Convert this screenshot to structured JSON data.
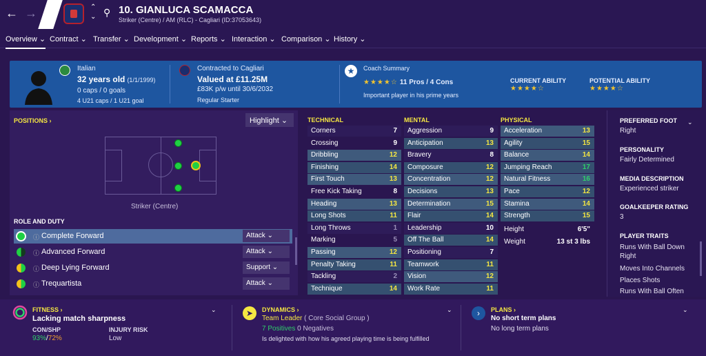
{
  "header": {
    "name": "10. GIANLUCA SCAMACCA",
    "subtitle": "Striker (Centre) / AM (RLC) - Cagliari (ID:37053643)"
  },
  "menu": [
    "Overview",
    "Contract",
    "Transfer",
    "Development",
    "Reports",
    "Interaction",
    "Comparison",
    "History"
  ],
  "summary": {
    "nationality": "Italian",
    "age": "32 years old",
    "dob": "(1/1/1999)",
    "caps": "0 caps / 0 goals",
    "u21": "4 U21 caps / 1 U21 goal",
    "contract_label": "Contracted to Cagliari",
    "value": "Valued at £11.25M",
    "wage": "£83K p/w until 30/6/2032",
    "status": "Regular Starter",
    "coach_title": "Coach Summary",
    "coach_pros": "11 Pros / 4 Cons",
    "coach_note": "Important player in his prime years",
    "ca_label": "CURRENT ABILITY",
    "pa_label": "POTENTIAL ABILITY",
    "ca_stars": 3.5,
    "pa_stars": 3.5
  },
  "positions": {
    "label": "POSITIONS",
    "highlight": "Highlight",
    "caption": "Striker (Centre)"
  },
  "role_duty": {
    "label": "ROLE AND DUTY",
    "roles": [
      {
        "name": "Complete Forward",
        "duty": "Attack"
      },
      {
        "name": "Advanced Forward",
        "duty": "Attack"
      },
      {
        "name": "Deep Lying Forward",
        "duty": "Support"
      },
      {
        "name": "Trequartista",
        "duty": "Attack"
      }
    ]
  },
  "technical": {
    "label": "TECHNICAL",
    "rows": [
      [
        "Corners",
        "7"
      ],
      [
        "Crossing",
        "9"
      ],
      [
        "Dribbling",
        "12"
      ],
      [
        "Finishing",
        "14"
      ],
      [
        "First Touch",
        "13"
      ],
      [
        "Free Kick Taking",
        "8"
      ],
      [
        "Heading",
        "13"
      ],
      [
        "Long Shots",
        "11"
      ],
      [
        "Long Throws",
        "1"
      ],
      [
        "Marking",
        "5"
      ],
      [
        "Passing",
        "12"
      ],
      [
        "Penalty Taking",
        "11"
      ],
      [
        "Tackling",
        "2"
      ],
      [
        "Technique",
        "14"
      ]
    ]
  },
  "mental": {
    "label": "MENTAL",
    "rows": [
      [
        "Aggression",
        "9"
      ],
      [
        "Anticipation",
        "13"
      ],
      [
        "Bravery",
        "8"
      ],
      [
        "Composure",
        "12"
      ],
      [
        "Concentration",
        "12"
      ],
      [
        "Decisions",
        "13"
      ],
      [
        "Determination",
        "15"
      ],
      [
        "Flair",
        "14"
      ],
      [
        "Leadership",
        "10"
      ],
      [
        "Off The Ball",
        "14"
      ],
      [
        "Positioning",
        "7"
      ],
      [
        "Teamwork",
        "11"
      ],
      [
        "Vision",
        "12"
      ],
      [
        "Work Rate",
        "11"
      ]
    ]
  },
  "physical": {
    "label": "PHYSICAL",
    "rows": [
      [
        "Acceleration",
        "13"
      ],
      [
        "Agility",
        "15"
      ],
      [
        "Balance",
        "14"
      ],
      [
        "Jumping Reach",
        "17"
      ],
      [
        "Natural Fitness",
        "16"
      ],
      [
        "Pace",
        "12"
      ],
      [
        "Stamina",
        "14"
      ],
      [
        "Strength",
        "15"
      ]
    ],
    "height_label": "Height",
    "height": "6'5\"",
    "weight_label": "Weight",
    "weight": "13 st 3 lbs"
  },
  "side": {
    "foot_h": "PREFERRED FOOT",
    "foot": "Right",
    "pers_h": "PERSONALITY",
    "pers": "Fairly Determined",
    "media_h": "MEDIA DESCRIPTION",
    "media": "Experienced striker",
    "gk_h": "GOALKEEPER RATING",
    "gk": "3",
    "traits_h": "PLAYER TRAITS",
    "traits": [
      "Runs With Ball Down Right",
      "Moves Into Channels",
      "Places Shots",
      "Runs With Ball Often"
    ]
  },
  "bottom": {
    "fit_h": "FITNESS",
    "fit_t": "Lacking match sharpness",
    "con_h": "CON/SHP",
    "con_a": "93%",
    "con_b": "72%",
    "inj_h": "INJURY RISK",
    "inj": "Low",
    "dyn_h": "DYNAMICS",
    "dyn_t": "Team Leader",
    "dyn_grp": "( Core Social Group )",
    "dyn_pos": "7 Positives",
    "dyn_neg": "0 Negatives",
    "dyn_note": "Is delighted with how his agreed playing time is being fulfilled",
    "plan_h": "PLANS",
    "plan_t": "No short term plans",
    "plan_s": "No long term plans"
  }
}
